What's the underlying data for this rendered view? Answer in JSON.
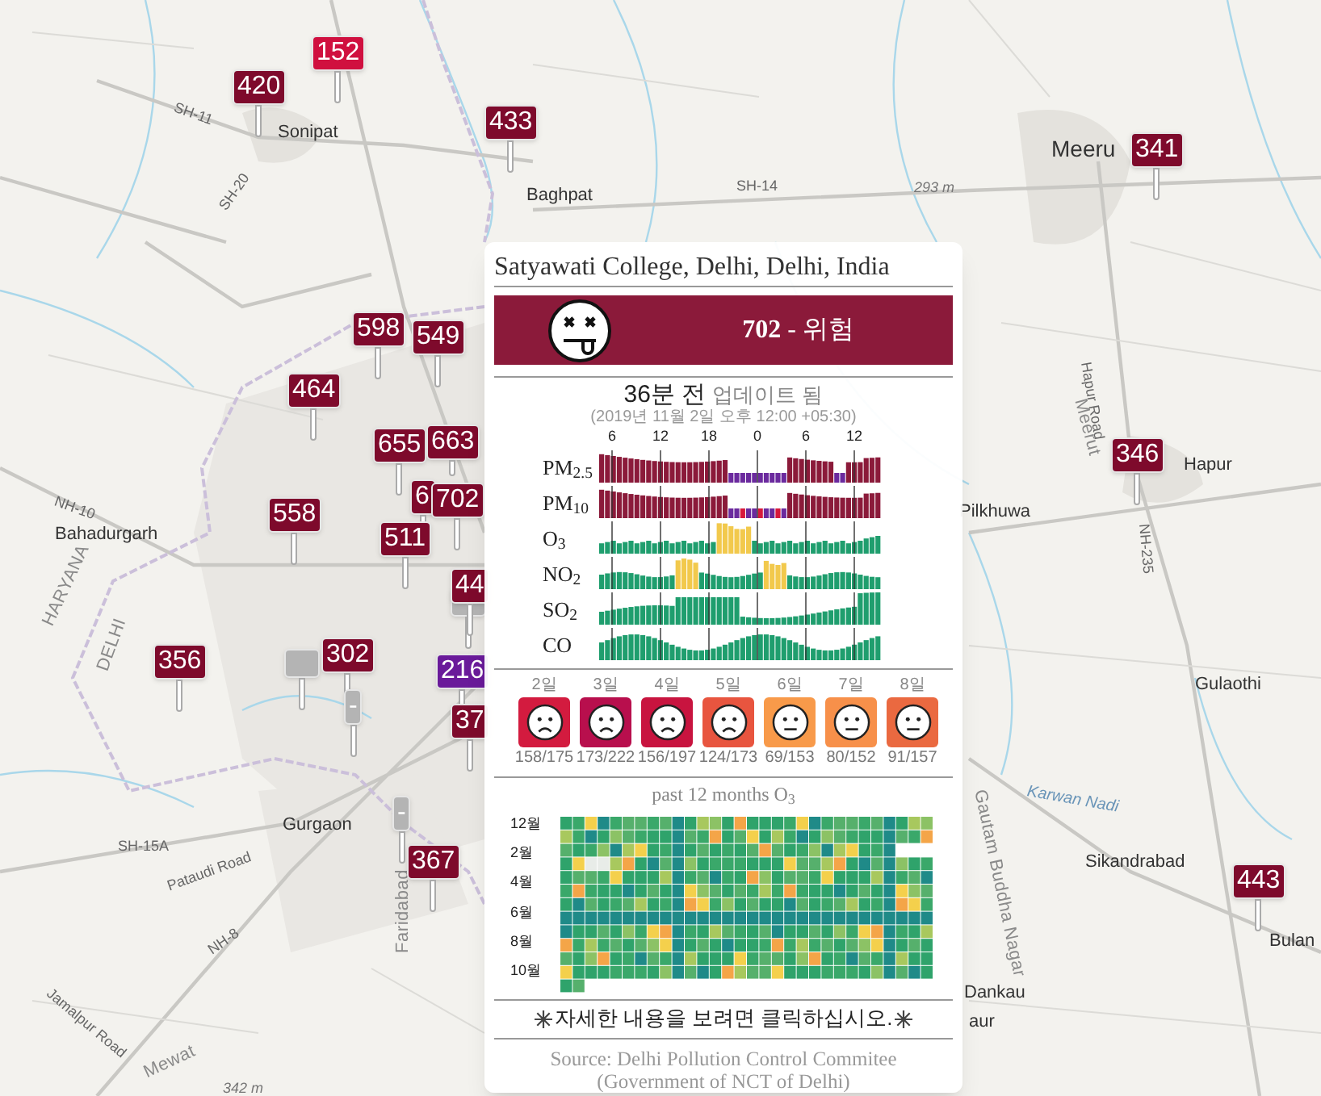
{
  "map": {
    "labels": [
      {
        "text": "Sonipat",
        "kind": "city"
      },
      {
        "text": "SH-11",
        "kind": "road"
      },
      {
        "text": "SH-20",
        "kind": "road"
      },
      {
        "text": "Baghpat",
        "kind": "city"
      },
      {
        "text": "SH-14",
        "kind": "road"
      },
      {
        "text": "293 m",
        "kind": "elevation"
      },
      {
        "text": "Meeru",
        "kind": "bigcity"
      },
      {
        "text": "Hapur Road",
        "kind": "road"
      },
      {
        "text": "Meerut",
        "kind": "region"
      },
      {
        "text": "Hapur",
        "kind": "city"
      },
      {
        "text": "NH-235",
        "kind": "road"
      },
      {
        "text": "Pilkhuwa",
        "kind": "city"
      },
      {
        "text": "Gulaothi",
        "kind": "city"
      },
      {
        "text": "Karwan Nadi",
        "kind": "river"
      },
      {
        "text": "Sikandrabad",
        "kind": "city"
      },
      {
        "text": "Bulan",
        "kind": "city"
      },
      {
        "text": "Gautam Buddha Nagar",
        "kind": "region"
      },
      {
        "text": "Dankau",
        "kind": "city"
      },
      {
        "text": "aur",
        "kind": "city"
      },
      {
        "text": "Bahadurgarh",
        "kind": "city"
      },
      {
        "text": "NH-10",
        "kind": "road"
      },
      {
        "text": "HARYANA",
        "kind": "region"
      },
      {
        "text": "DELHI",
        "kind": "region"
      },
      {
        "text": "Gurgaon",
        "kind": "city"
      },
      {
        "text": "SH-15A",
        "kind": "road"
      },
      {
        "text": "Pataudi Road",
        "kind": "road"
      },
      {
        "text": "NH-8",
        "kind": "road"
      },
      {
        "text": "Jamalpur Road",
        "kind": "road"
      },
      {
        "text": "Mewat",
        "kind": "region"
      },
      {
        "text": "342 m",
        "kind": "elevation"
      },
      {
        "text": "Faridabad",
        "kind": "region"
      }
    ],
    "markers": [
      {
        "value": "420",
        "color": "#7e0a2c"
      },
      {
        "value": "152",
        "color": "#d0103f"
      },
      {
        "value": "433",
        "color": "#7e0a2c"
      },
      {
        "value": "598",
        "color": "#7e0a2c"
      },
      {
        "value": "549",
        "color": "#7e0a2c"
      },
      {
        "value": "464",
        "color": "#7e0a2c"
      },
      {
        "value": "655",
        "color": "#7e0a2c"
      },
      {
        "value": "663",
        "color": "#7e0a2c"
      },
      {
        "value": "6",
        "color": "#7e0a2c"
      },
      {
        "value": "702",
        "color": "#7e0a2c"
      },
      {
        "value": "558",
        "color": "#7e0a2c"
      },
      {
        "value": "511",
        "color": "#7e0a2c"
      },
      {
        "color": "#b4b4b4"
      },
      {
        "value": "44",
        "color": "#7e0a2c"
      },
      {
        "value": "356",
        "color": "#7e0a2c"
      },
      {
        "color": "#b4b4b4"
      },
      {
        "value": "302",
        "color": "#7e0a2c"
      },
      {
        "value": "-",
        "color": "#b4b4b4"
      },
      {
        "value": "216",
        "color": "#6a1a9a"
      },
      {
        "value": "37",
        "color": "#7e0a2c"
      },
      {
        "value": "-",
        "color": "#b4b4b4"
      },
      {
        "value": "367",
        "color": "#7e0a2c"
      },
      {
        "value": "341",
        "color": "#7e0a2c"
      },
      {
        "value": "346",
        "color": "#7e0a2c"
      },
      {
        "value": "443",
        "color": "#7e0a2c"
      }
    ]
  },
  "popup": {
    "title": "Satyawati College, Delhi, Delhi, India",
    "aqi": {
      "text": "**702** - 위험",
      "color": "#8b1a3a"
    },
    "updated": {
      "age": "36분 전",
      "label": "업데이트 됨"
    },
    "timestamp": "(2019년 11월 2일 오후 12:00 +05:30)",
    "hour_ticks": [
      "6",
      "12",
      "18",
      "0",
      "6",
      "12"
    ],
    "pollutants": [
      {
        "label": "PM$_{2.5}$"
      },
      {
        "label": "PM$_{10}$"
      },
      {
        "label": "O$_{3}$"
      },
      {
        "label": "NO$_{2}$"
      },
      {
        "label": "SO$_{2}$"
      },
      {
        "label": "CO"
      }
    ],
    "forecast": [
      {
        "day": "2일",
        "kind": "sad",
        "color": "#d31b3f",
        "reading": "158/175"
      },
      {
        "day": "3일",
        "kind": "sad",
        "color": "#b80f4d",
        "reading": "173/222"
      },
      {
        "day": "4일",
        "kind": "sad",
        "color": "#c8143f",
        "reading": "156/197"
      },
      {
        "day": "5일",
        "kind": "sad",
        "color": "#e8553f",
        "reading": "124/173"
      },
      {
        "day": "6일",
        "kind": "neutral",
        "color": "#f89a4a",
        "reading": "69/153"
      },
      {
        "day": "7일",
        "kind": "neutral",
        "color": "#f7904a",
        "reading": "80/152"
      },
      {
        "day": "8일",
        "kind": "neutral",
        "color": "#ea6940",
        "reading": "91/157"
      }
    ],
    "history_title": "past 12 months O$_{3}$",
    "month_labels": [
      "12월",
      "2월",
      "4월",
      "6월",
      "8월",
      "10월"
    ],
    "link": "자세한 내용을 보려면 클릭하십시오.",
    "source": "Source: Delhi Pollution Control Commitee (Government of NCT of Delhi)"
  }
}
